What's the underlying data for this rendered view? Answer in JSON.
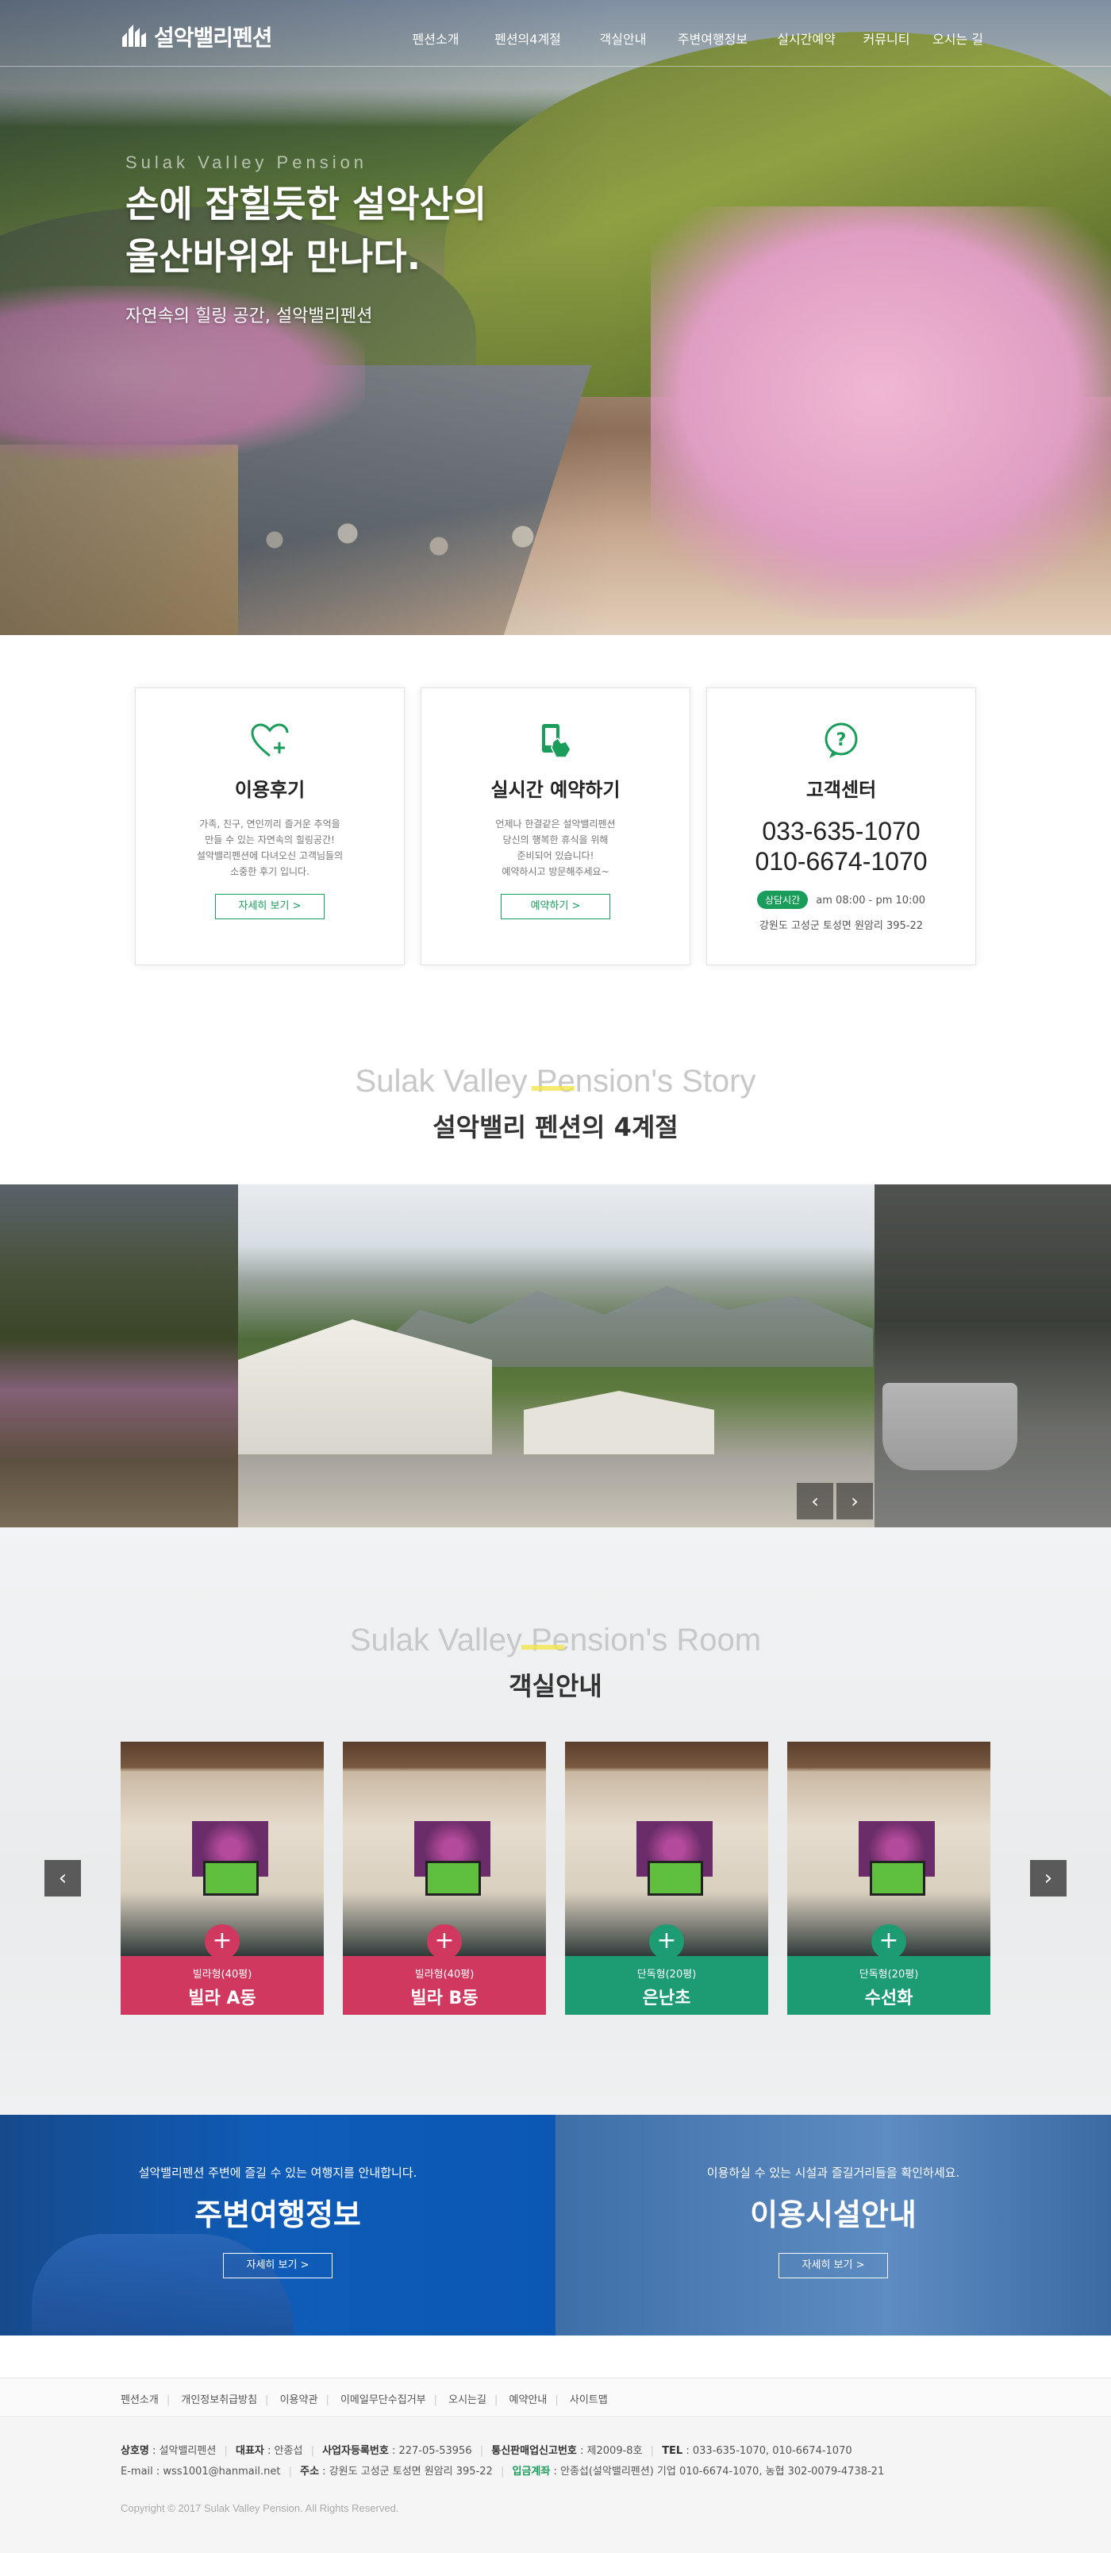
{
  "brand": {
    "name": "설악밸리펜션"
  },
  "nav": [
    "펜션소개",
    "펜션의4계절",
    "객실안내",
    "주변여행정보",
    "실시간예약",
    "커뮤니티",
    "오시는 길"
  ],
  "hero": {
    "en": "Sulak Valley Pension",
    "title_line1": "손에 잡힐듯한 설악산의",
    "title_line2": "울산바위와 만나다.",
    "subtitle": "자연속의 힐링 공간, 설악밸리펜션"
  },
  "cards": {
    "review": {
      "title": "이용후기",
      "desc": "가족, 친구, 연인끼리 즐거운 추억을\n만들 수 있는 자연속의 힐링공간!\n설악밸리펜션에 다녀오신 고객님들의\n소중한 후기 입니다.",
      "button": "자세히 보기 >",
      "icon": "heart-plus-icon"
    },
    "reserve": {
      "title": "실시간 예약하기",
      "desc": "언제나 한결같은 설악밸리펜션\n당신의 행복한 휴식을 위해\n준비되어 있습니다!\n예약하시고 방문해주세요~",
      "button": "예약하기 >",
      "icon": "phone-touch-icon"
    },
    "cs": {
      "title": "고객센터",
      "phone1": "033-635-1070",
      "phone2": "010-6674-1070",
      "badge": "상담시간",
      "hours": "am 08:00 - pm 10:00",
      "address": "강원도 고성군 토성면 원암리 395-22",
      "icon": "question-bubble-icon"
    }
  },
  "story": {
    "en": "Sulak Valley Pension's Story",
    "ko": "설악밸리 펜션의 4계절",
    "prev": "‹",
    "next": "›"
  },
  "rooms": {
    "en": "Sulak Valley Pension's Room",
    "ko": "객실안내",
    "prev": "‹",
    "next": "›",
    "plus": "+",
    "items": [
      {
        "type": "빌라형(40평)",
        "name": "빌라 A동",
        "color": "#d0385f"
      },
      {
        "type": "빌라형(40평)",
        "name": "빌라 B동",
        "color": "#d0385f"
      },
      {
        "type": "단독형(20평)",
        "name": "은난초",
        "color": "#1d9b73"
      },
      {
        "type": "단독형(20평)",
        "name": "수선화",
        "color": "#1d9b73"
      }
    ]
  },
  "promo": {
    "travel": {
      "desc": "설악밸리펜션 주변에 즐길 수 있는 여행지를 안내합니다.",
      "title": "주변여행정보",
      "button": "자세히 보기 >"
    },
    "facility": {
      "desc": "이용하실 수 있는 시설과 즐길거리들을 확인하세요.",
      "title": "이용시설안내",
      "button": "자세히 보기 >"
    }
  },
  "footer": {
    "links": [
      "펜션소개",
      "개인정보취급방침",
      "이용약관",
      "이메일무단수집거부",
      "오시는길",
      "예약안내",
      "사이트맵"
    ],
    "row1": {
      "k1": "상호명",
      "v1": "설악밸리펜션",
      "k2": "대표자",
      "v2": "안종섭",
      "k3": "사업자등록번호",
      "v3": "227-05-53956",
      "k4": "통신판매업신고번호",
      "v4": "제2009-8호",
      "k5": "TEL",
      "v5": "033-635-1070, 010-6674-1070"
    },
    "row2": {
      "k1": "E-mail",
      "v1": "wss1001@hanmail.net",
      "k2": "주소",
      "v2": "강원도 고성군 토성면 원암리 395-22",
      "k3": "입금계좌",
      "v3": "안종섭(설악밸리펜션) 기업 010-6674-1070, 농협 302-0079-4738-21"
    },
    "copyright": "Copyright © 2017 Sulak Valley Pension. All Rights Reserved."
  },
  "colors": {
    "green": "#1a9c5a",
    "pink": "#d0385f",
    "teal": "#1d9b73",
    "blue": "#0e5cb8"
  }
}
